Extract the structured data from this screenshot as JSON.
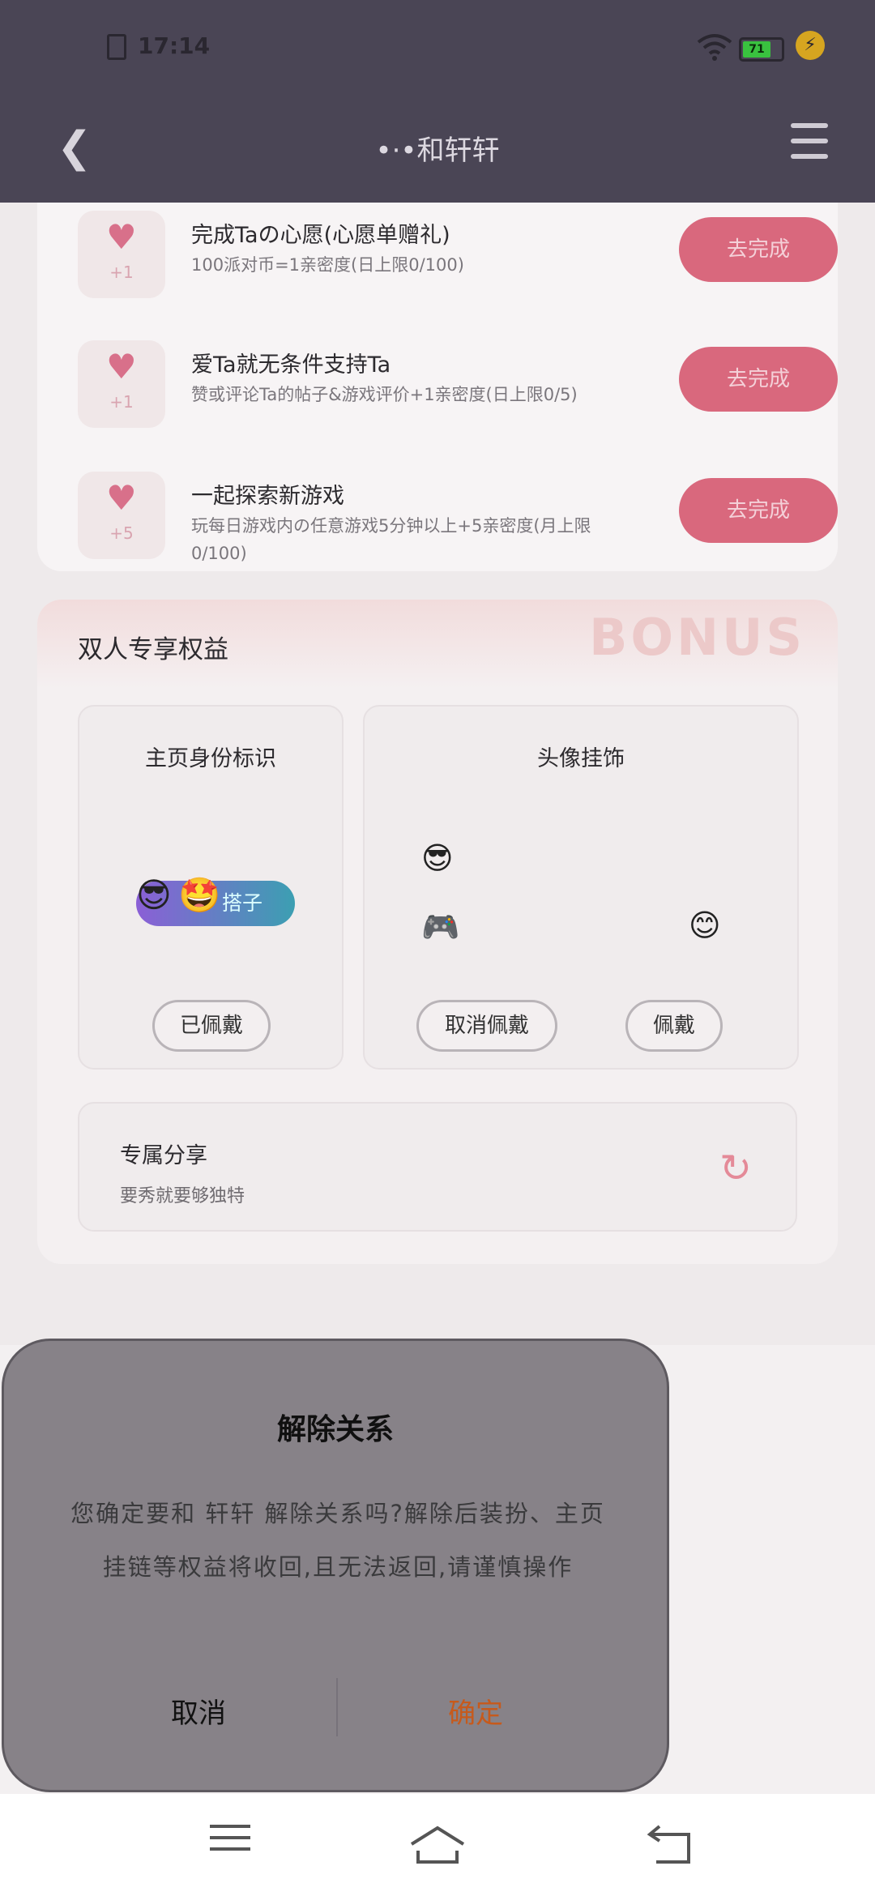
{
  "status": {
    "time": "17:14",
    "battery": "71"
  },
  "header": {
    "title": "•·•和轩轩"
  },
  "tasks": [
    {
      "title": "完成Taの心愿(心愿单赠礼)",
      "subtitle": "100派对币=1亲密度(日上限0/100)",
      "plus": "+1",
      "button": "去完成"
    },
    {
      "title": "爱Ta就无条件支持Ta",
      "subtitle": "赞或评论Ta的帖子&游戏评价+1亲密度(日上限0/5)",
      "plus": "+1",
      "button": "去完成"
    },
    {
      "title": "一起探索新游戏",
      "subtitle": "玩每日游戏内の任意游戏5分钟以上+5亲密度(月上限0/100)",
      "plus": "+5",
      "button": "去完成"
    }
  ],
  "benefits": {
    "title": "双人专享权益",
    "bonus_art": "BONUS",
    "homepage_badge": {
      "label": "主页身份标识",
      "tag": "搭子",
      "button": "已佩戴"
    },
    "avatar_frame": {
      "label": "头像挂饰",
      "button_left": "取消佩戴",
      "button_right": "佩戴"
    },
    "share": {
      "title": "专属分享",
      "subtitle": "要秀就要够独特"
    }
  },
  "dialog": {
    "title": "解除关系",
    "message": "您确定要和 轩轩 解除关系吗?解除后装扮、主页挂链等权益将收回,且无法返回,请谨慎操作",
    "cancel": "取消",
    "confirm": "确定"
  }
}
